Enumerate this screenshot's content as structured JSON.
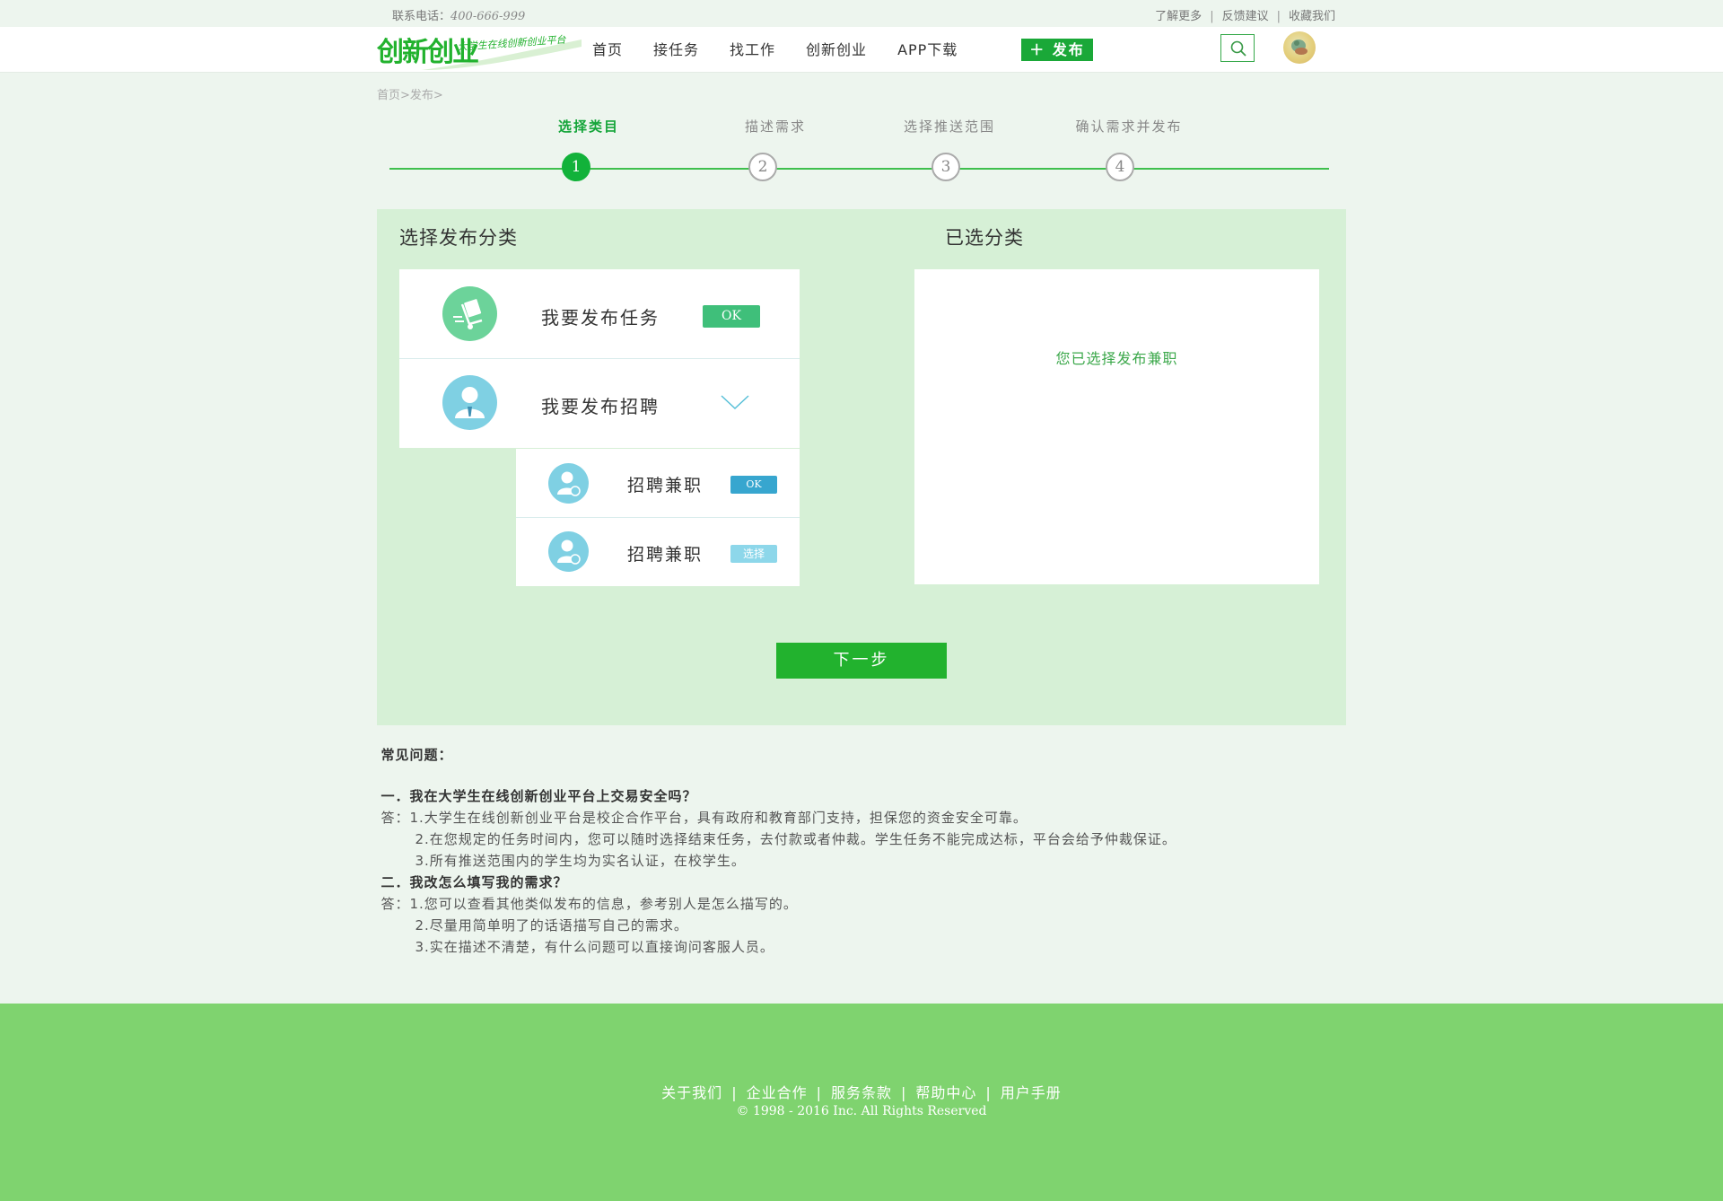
{
  "topbar": {
    "phone_label": "联系电话：",
    "phone_number": "400-666-999",
    "links": [
      "了解更多",
      "反馈建议",
      "收藏我们"
    ]
  },
  "header": {
    "logo_text": "创新创业",
    "logo_slogan": "大学生在线创新创业平台",
    "nav": [
      "首页",
      "接任务",
      "找工作",
      "创新创业",
      "APP下载"
    ],
    "publish_label": "＋ 发布",
    "search_icon": "search-icon",
    "avatar_icon": "avatar"
  },
  "breadcrumb": [
    "首页>",
    "发布>"
  ],
  "steps": [
    {
      "label": "选择类目",
      "number": "1",
      "active": true
    },
    {
      "label": "描述需求",
      "number": "2",
      "active": false
    },
    {
      "label": "选择推送范围",
      "number": "3",
      "active": false
    },
    {
      "label": "确认需求并发布",
      "number": "4",
      "active": false
    }
  ],
  "panel": {
    "left_title": "选择发布分类",
    "right_title": "已选分类",
    "options": [
      {
        "label": "我要发布任务",
        "badge": "OK"
      },
      {
        "label": "我要发布招聘"
      }
    ],
    "sub_options": [
      {
        "label": "招聘兼职",
        "badge": "OK"
      },
      {
        "label": "招聘兼职",
        "badge": "选择"
      }
    ],
    "selected_message": "您已选择发布兼职",
    "next_label": "下一步"
  },
  "faq": {
    "title": "常见问题：",
    "items": [
      {
        "question": "一．我在大学生在线创新创业平台上交易安全吗？",
        "answers": [
          "答：1.大学生在线创新创业平台是校企合作平台，具有政府和教育部门支持，担保您的资金安全可靠。",
          "2.在您规定的任务时间内，您可以随时选择结束任务，去付款或者仲裁。学生任务不能完成达标，平台会给予仲裁保证。",
          "3.所有推送范围内的学生均为实名认证，在校学生。"
        ]
      },
      {
        "question": "二．我改怎么填写我的需求？",
        "answers": [
          "答：1.您可以查看其他类似发布的信息，参考别人是怎么描写的。",
          "2.尽量用简单明了的话语描写自己的需求。",
          "3.实在描述不清楚，有什么问题可以直接询问客服人员。"
        ]
      }
    ]
  },
  "footer": {
    "links": [
      "关于我们",
      "企业合作",
      "服务条款",
      "帮助中心",
      "用户手册"
    ],
    "copyright": "© 1998 - 2016  Inc. All Rights Reserved"
  },
  "colors": {
    "brand_green": "#22b22e",
    "panel_bg": "#d6f0d6",
    "footer_bg": "#7fd36f",
    "task_icon_bg": "#6cd39a",
    "recruit_icon_bg": "#7fd0e3",
    "ok_task": "#3fbf7a",
    "ok_recruit": "#37a6cf",
    "select_badge": "#8dd7ea"
  }
}
